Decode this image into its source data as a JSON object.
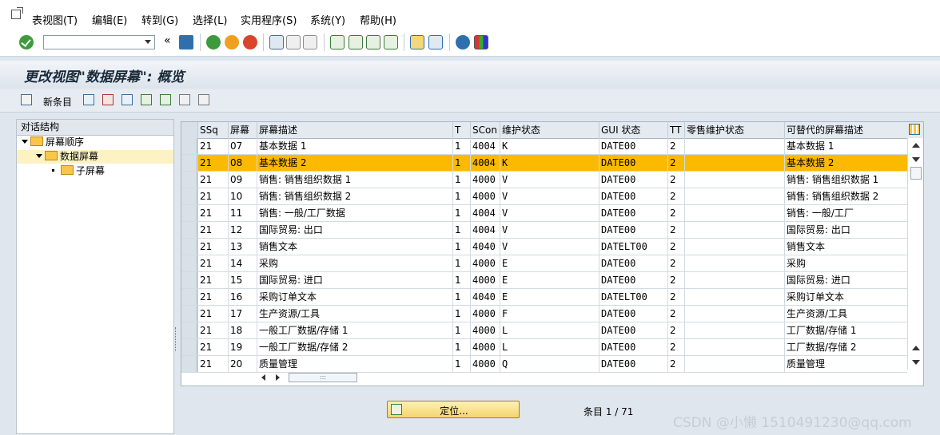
{
  "menu": [
    "表视图(T)",
    "编辑(E)",
    "转到(G)",
    "选择(L)",
    "实用程序(S)",
    "系统(Y)",
    "帮助(H)"
  ],
  "toolbar": {
    "collapse_glyph": "«"
  },
  "title": "更改视图\"数据屏幕\": 概览",
  "app_toolbar": {
    "new_entries_label": "新条目"
  },
  "tree": {
    "header": "对话结构",
    "nodes": [
      "屏幕顺序",
      "数据屏幕",
      "子屏幕"
    ]
  },
  "table": {
    "headers": [
      "SSq",
      "屏幕",
      "屏幕描述",
      "T",
      "SCon",
      "维护状态",
      "GUI 状态",
      "TT",
      "零售维护状态",
      "可替代的屏幕描述"
    ],
    "rows": [
      [
        "21",
        "07",
        "基本数据 1",
        "1",
        "4004",
        "K",
        "DATE00",
        "2",
        "",
        "基本数据 1"
      ],
      [
        "21",
        "08",
        "基本数据 2",
        "1",
        "4004",
        "K",
        "DATE00",
        "2",
        "",
        "基本数据 2"
      ],
      [
        "21",
        "09",
        "销售: 销售组织数据 1",
        "1",
        "4000",
        "V",
        "DATE00",
        "2",
        "",
        "销售: 销售组织数据 1"
      ],
      [
        "21",
        "10",
        "销售: 销售组织数据 2",
        "1",
        "4000",
        "V",
        "DATE00",
        "2",
        "",
        "销售: 销售组织数据 2"
      ],
      [
        "21",
        "11",
        "销售: 一般/工厂数据",
        "1",
        "4004",
        "V",
        "DATE00",
        "2",
        "",
        "销售: 一般/工厂"
      ],
      [
        "21",
        "12",
        "国际贸易: 出口",
        "1",
        "4004",
        "V",
        "DATE00",
        "2",
        "",
        "国际贸易: 出口"
      ],
      [
        "21",
        "13",
        "销售文本",
        "1",
        "4040",
        "V",
        "DATELT00",
        "2",
        "",
        "销售文本"
      ],
      [
        "21",
        "14",
        "采购",
        "1",
        "4000",
        "E",
        "DATE00",
        "2",
        "",
        "采购"
      ],
      [
        "21",
        "15",
        "国际贸易: 进口",
        "1",
        "4000",
        "E",
        "DATE00",
        "2",
        "",
        "国际贸易: 进口"
      ],
      [
        "21",
        "16",
        "采购订单文本",
        "1",
        "4040",
        "E",
        "DATELT00",
        "2",
        "",
        "采购订单文本"
      ],
      [
        "21",
        "17",
        "生产资源/工具",
        "1",
        "4000",
        "F",
        "DATE00",
        "2",
        "",
        "生产资源/工具"
      ],
      [
        "21",
        "18",
        "一般工厂数据/存储 1",
        "1",
        "4000",
        "L",
        "DATE00",
        "2",
        "",
        "工厂数据/存储 1"
      ],
      [
        "21",
        "19",
        "一般工厂数据/存储 2",
        "1",
        "4000",
        "L",
        "DATE00",
        "2",
        "",
        "工厂数据/存储 2"
      ],
      [
        "21",
        "20",
        "质量管理",
        "1",
        "4000",
        "Q",
        "DATE00",
        "2",
        "",
        "质量管理"
      ]
    ],
    "selected_row": 1,
    "hscroll_thumb": ":::"
  },
  "footer": {
    "position_button": "定位...",
    "entries": "条目 1 / 71"
  },
  "watermark": "CSDN @小懒 1510491230@qq.com",
  "colors": {
    "selected": "#fbb900",
    "background": "#dfe6ee"
  }
}
